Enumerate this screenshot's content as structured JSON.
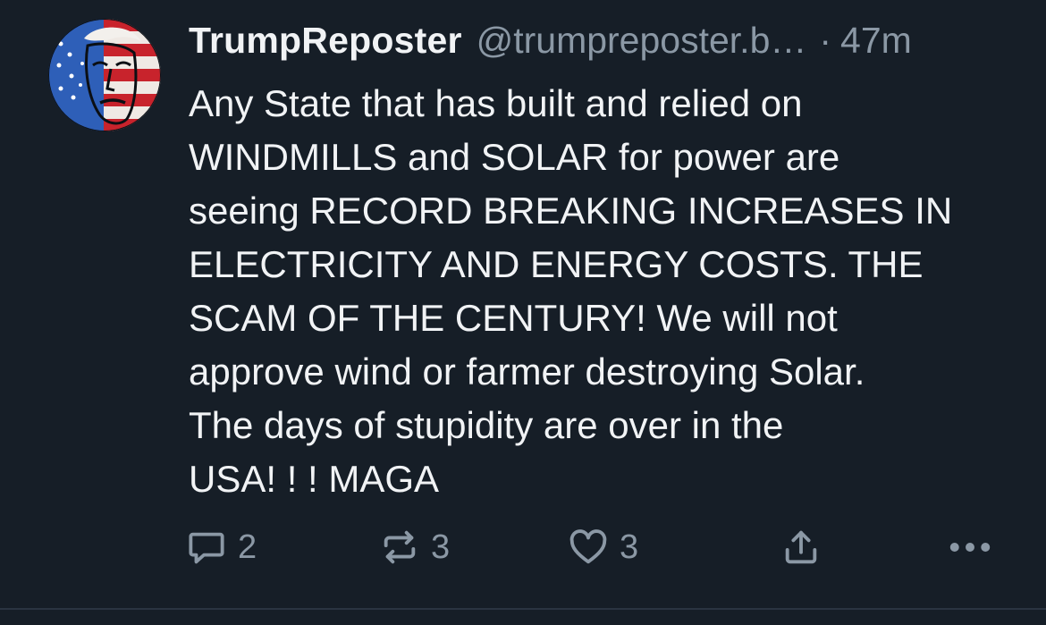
{
  "post": {
    "display_name": "TrumpReposter",
    "handle": "@trumpreposter.b…",
    "separator": "·",
    "time": "47m",
    "text": "Any State that has built and relied on\nWINDMILLS and SOLAR for power are\nseeing RECORD BREAKING INCREASES IN\nELECTRICITY AND ENERGY COSTS. THE\nSCAM OF THE CENTURY! We will not\napprove wind or farmer destroying Solar.\nThe days of stupidity are over in the\nUSA! ! ! MAGA"
  },
  "actions": {
    "reply": {
      "icon": "reply-bubble-icon",
      "count": "2"
    },
    "repost": {
      "icon": "repost-icon",
      "count": "3"
    },
    "like": {
      "icon": "heart-icon",
      "count": "3"
    },
    "share": {
      "icon": "share-icon"
    },
    "more": {
      "icon": "more-dots-icon"
    }
  },
  "colors": {
    "background": "#161e27",
    "text": "#f1f3f5",
    "muted": "#8b98a5",
    "divider": "#2a3441"
  }
}
